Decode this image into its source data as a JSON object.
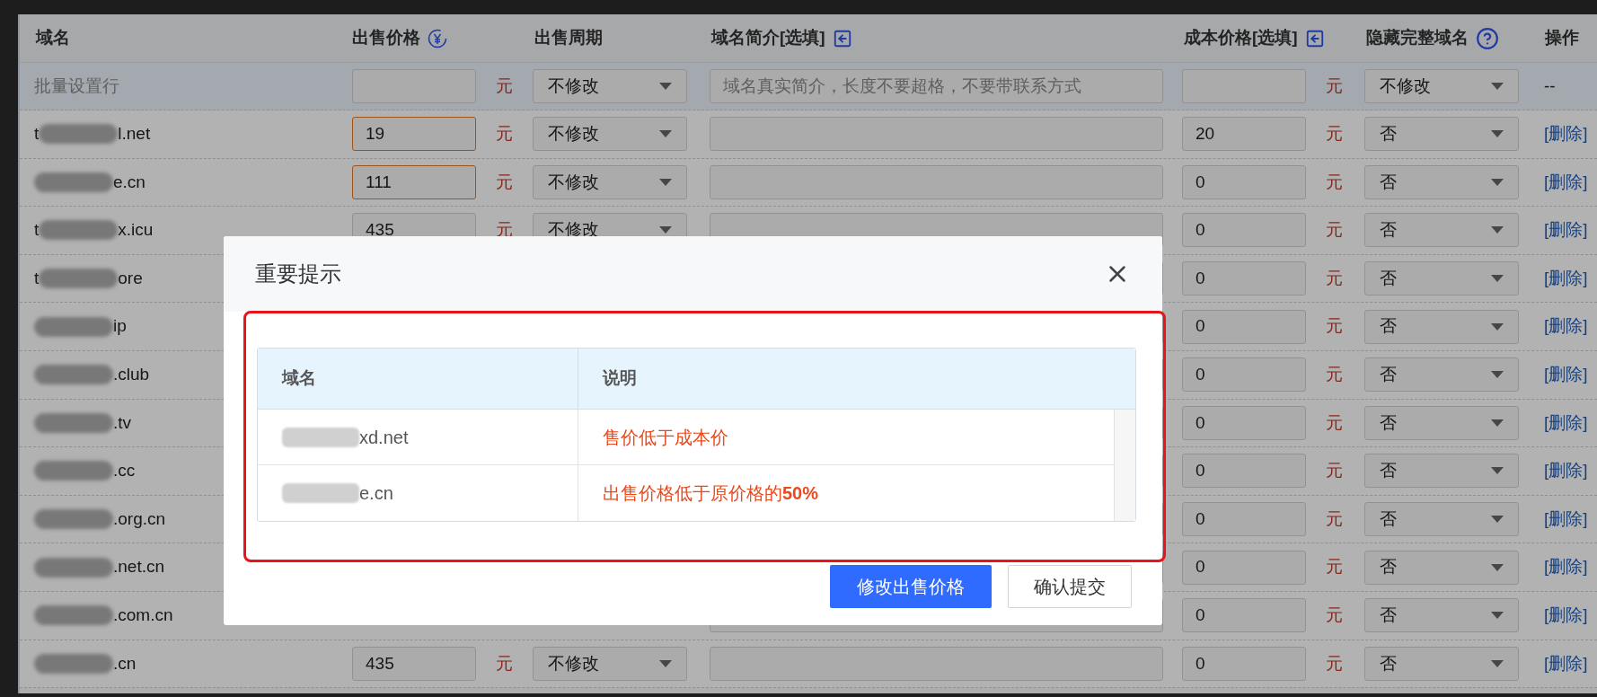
{
  "table": {
    "columns": [
      {
        "label": "域名"
      },
      {
        "label": "出售价格"
      },
      {
        "label": "出售周期"
      },
      {
        "label": "域名简介[选填]"
      },
      {
        "label": "成本价格[选填]"
      },
      {
        "label": "隐藏完整域名"
      },
      {
        "label": "操作"
      }
    ],
    "batch_row": {
      "label": "批量设置行",
      "price_unit": "元",
      "period": "不修改",
      "intro_placeholder": "域名真实简介，长度不要超格，不要带联系方式",
      "cost_unit": "元",
      "hide": "不修改",
      "action": "--"
    },
    "rows": [
      {
        "domain": "t",
        "domain_end": "l.net",
        "price": "19",
        "price_error": true,
        "price_unit": "元",
        "period": "不修改",
        "cost": "20",
        "cost_unit": "元",
        "hide": "否",
        "action": "[删除]"
      },
      {
        "domain": "",
        "domain_end": "e.cn",
        "price": "111",
        "price_error": true,
        "price_unit": "元",
        "period": "不修改",
        "cost": "0",
        "cost_unit": "元",
        "hide": "否",
        "action": "[删除]"
      },
      {
        "domain": "t",
        "domain_end": "x.icu",
        "price": "435",
        "price_error": false,
        "price_unit": "元",
        "period": "不修改",
        "cost": "0",
        "cost_unit": "元",
        "hide": "否",
        "action": "[删除]"
      },
      {
        "domain": "t",
        "domain_end": "ore",
        "cost": "0",
        "cost_unit": "元",
        "hide": "否",
        "action": "[删除]"
      },
      {
        "domain": "",
        "domain_end": "ip",
        "cost": "0",
        "cost_unit": "元",
        "hide": "否",
        "action": "[删除]"
      },
      {
        "domain": "",
        "domain_end": ".club",
        "cost": "0",
        "cost_unit": "元",
        "hide": "否",
        "action": "[删除]"
      },
      {
        "domain": "",
        "domain_end": ".tv",
        "cost": "0",
        "cost_unit": "元",
        "hide": "否",
        "action": "[删除]"
      },
      {
        "domain": "",
        "domain_end": ".cc",
        "cost": "0",
        "cost_unit": "元",
        "hide": "否",
        "action": "[删除]"
      },
      {
        "domain": "",
        "domain_end": ".org.cn",
        "cost": "0",
        "cost_unit": "元",
        "hide": "否",
        "action": "[删除]"
      },
      {
        "domain": "",
        "domain_end": ".net.cn",
        "cost": "0",
        "cost_unit": "元",
        "hide": "否",
        "action": "[删除]"
      },
      {
        "domain": "",
        "domain_end": ".com.cn",
        "cost": "0",
        "cost_unit": "元",
        "hide": "否",
        "action": "[删除]"
      },
      {
        "domain": "",
        "domain_end": ".cn",
        "price": "435",
        "price_error": false,
        "price_unit": "元",
        "period": "不修改",
        "cost": "0",
        "cost_unit": "元",
        "hide": "否",
        "action": "[删除]"
      }
    ]
  },
  "dialog": {
    "title": "重要提示",
    "columns": [
      "域名",
      "说明"
    ],
    "rows": [
      {
        "domain": "xd.net",
        "note": "售价低于成本价"
      },
      {
        "domain": "e.cn",
        "note": "出售价格低于原价格的**50%**"
      }
    ],
    "buttons": [
      {
        "label": "修改出售价格",
        "primary": true
      },
      {
        "label": "确认提交",
        "primary": false
      }
    ]
  }
}
